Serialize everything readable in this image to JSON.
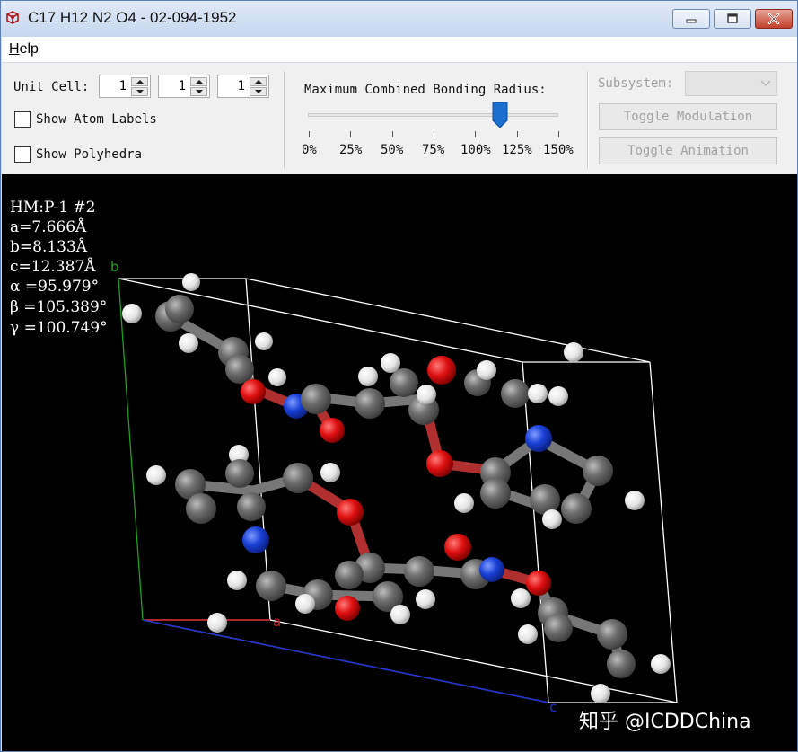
{
  "window": {
    "title": "C17 H12 N2 O4 - 02-094-1952"
  },
  "menu": {
    "help_prefix": "H",
    "help_rest": "elp"
  },
  "toolbar": {
    "unit_cell_label": "Unit Cell:",
    "unit_cell_values": [
      "1",
      "1",
      "1"
    ],
    "show_atom_labels": "Show Atom Labels",
    "show_polyhedra": "Show Polyhedra",
    "bonding_radius_label": "Maximum Combined Bonding Radius:",
    "bonding_radius_value_percent": 115,
    "bonding_ticks": [
      "0%",
      "25%",
      "50%",
      "75%",
      "100%",
      "125%",
      "150%"
    ],
    "subsystem_label": "Subsystem:",
    "toggle_modulation": "Toggle Modulation",
    "toggle_animation": "Toggle Animation"
  },
  "viewer": {
    "info_lines": [
      "HM:P-1 #2",
      "a=7.666Å",
      "b=8.133Å",
      "c=12.387Å",
      "α =95.979°",
      "β =105.389°",
      "γ =100.749°"
    ],
    "axis_a": "a",
    "axis_b": "b",
    "axis_c": "c",
    "watermark": "知乎 @ICDDChina",
    "colors": {
      "carbon": "#6e6e6e",
      "hydrogen": "#e8e8e8",
      "oxygen": "#e01010",
      "nitrogen": "#1a3fd6",
      "axis_a": "#cc2020",
      "axis_b": "#20a020",
      "axis_c": "#2030d0"
    }
  }
}
